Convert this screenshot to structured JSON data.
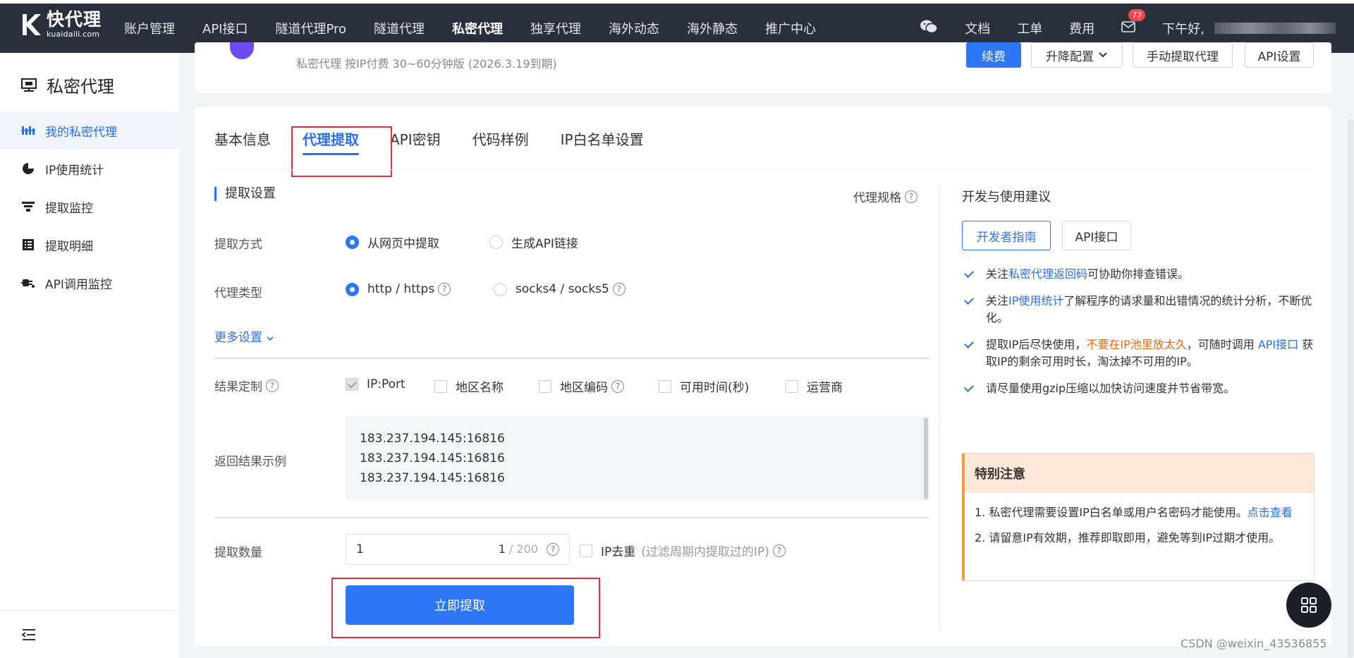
{
  "brand": {
    "name": "快代理",
    "domain": "kuaidaili.com"
  },
  "nav": {
    "items": [
      "账户管理",
      "API接口",
      "隧道代理Pro",
      "隧道代理",
      "私密代理",
      "独享代理",
      "海外动态",
      "海外静态",
      "推广中心"
    ],
    "active": "私密代理",
    "right": {
      "docs": "文档",
      "tickets": "工单",
      "fees": "费用",
      "mail_badge": "77",
      "greeting": "下午好,"
    }
  },
  "sidebar": {
    "title": "私密代理",
    "items": [
      {
        "label": "我的私密代理",
        "icon": "bars-icon"
      },
      {
        "label": "IP使用统计",
        "icon": "pie-chart-icon"
      },
      {
        "label": "提取监控",
        "icon": "filter-icon"
      },
      {
        "label": "提取明细",
        "icon": "list-icon"
      },
      {
        "label": "API调用监控",
        "icon": "plug-icon"
      }
    ]
  },
  "product": {
    "info": "私密代理  按IP付费  30~60分钟版   (2026.3.19到期)",
    "buttons": {
      "renew": "续费",
      "upgrade": "升降配置",
      "manual": "手动提取代理",
      "api_settings": "API设置"
    }
  },
  "tabs": [
    "基本信息",
    "代理提取",
    "API密钥",
    "代码样例",
    "IP白名单设置"
  ],
  "extract": {
    "section_title": "提取设置",
    "spec_link": "代理规格",
    "method_label": "提取方式",
    "method_options": [
      "从网页中提取",
      "生成API链接"
    ],
    "type_label": "代理类型",
    "type_options": [
      "http / https",
      "socks4 / socks5"
    ],
    "more_settings": "更多设置",
    "result_custom_label": "结果定制",
    "result_fields": [
      "IP:Port",
      "地区名称",
      "地区编码",
      "可用时间(秒)",
      "运营商"
    ],
    "example_label": "返回结果示例",
    "example_lines": [
      "183.237.194.145:16816",
      "183.237.194.145:16816",
      "183.237.194.145:16816"
    ],
    "qty_label": "提取数量",
    "qty_value": "1",
    "qty_count": "1",
    "qty_max": " / 200",
    "dedup_label": "IP去重",
    "dedup_hint": "(过滤周期内提取过的IP)",
    "submit": "立即提取"
  },
  "aside": {
    "title": "开发与使用建议",
    "btn_guide": "开发者指南",
    "btn_api": "API接口",
    "tip1_a": "关注",
    "tip1_link": "私密代理返回码",
    "tip1_b": "可协助你排查错误。",
    "tip2_a": "关注",
    "tip2_link": "IP使用统计",
    "tip2_b": "了解程序的请求量和出错情况的统计分析，不断优化。",
    "tip3_a": "提取IP后尽快使用，",
    "tip3_warn": "不要在IP池里放太久",
    "tip3_b": "，可随时调用 ",
    "tip3_link": "API接口",
    "tip3_c": " 获取IP的剩余可用时长，淘汰掉不可用的IP。",
    "tip4": "请尽量使用gzip压缩以加快访问速度并节省带宽。",
    "notice_title": "特别注意",
    "notice1_a": "1. 私密代理需要设置IP白名单或用户名密码才能使用。",
    "notice1_link": "点击查看",
    "notice2": "2. 请留意IP有效期，推荐即取即用，避免等到IP过期才使用。"
  },
  "watermark": "CSDN @weixin_43536855",
  "colors": {
    "primary": "#2d76f6",
    "topbar": "#2a2f3c",
    "highlight": "#e5303a",
    "warn": "#f06a0c"
  }
}
